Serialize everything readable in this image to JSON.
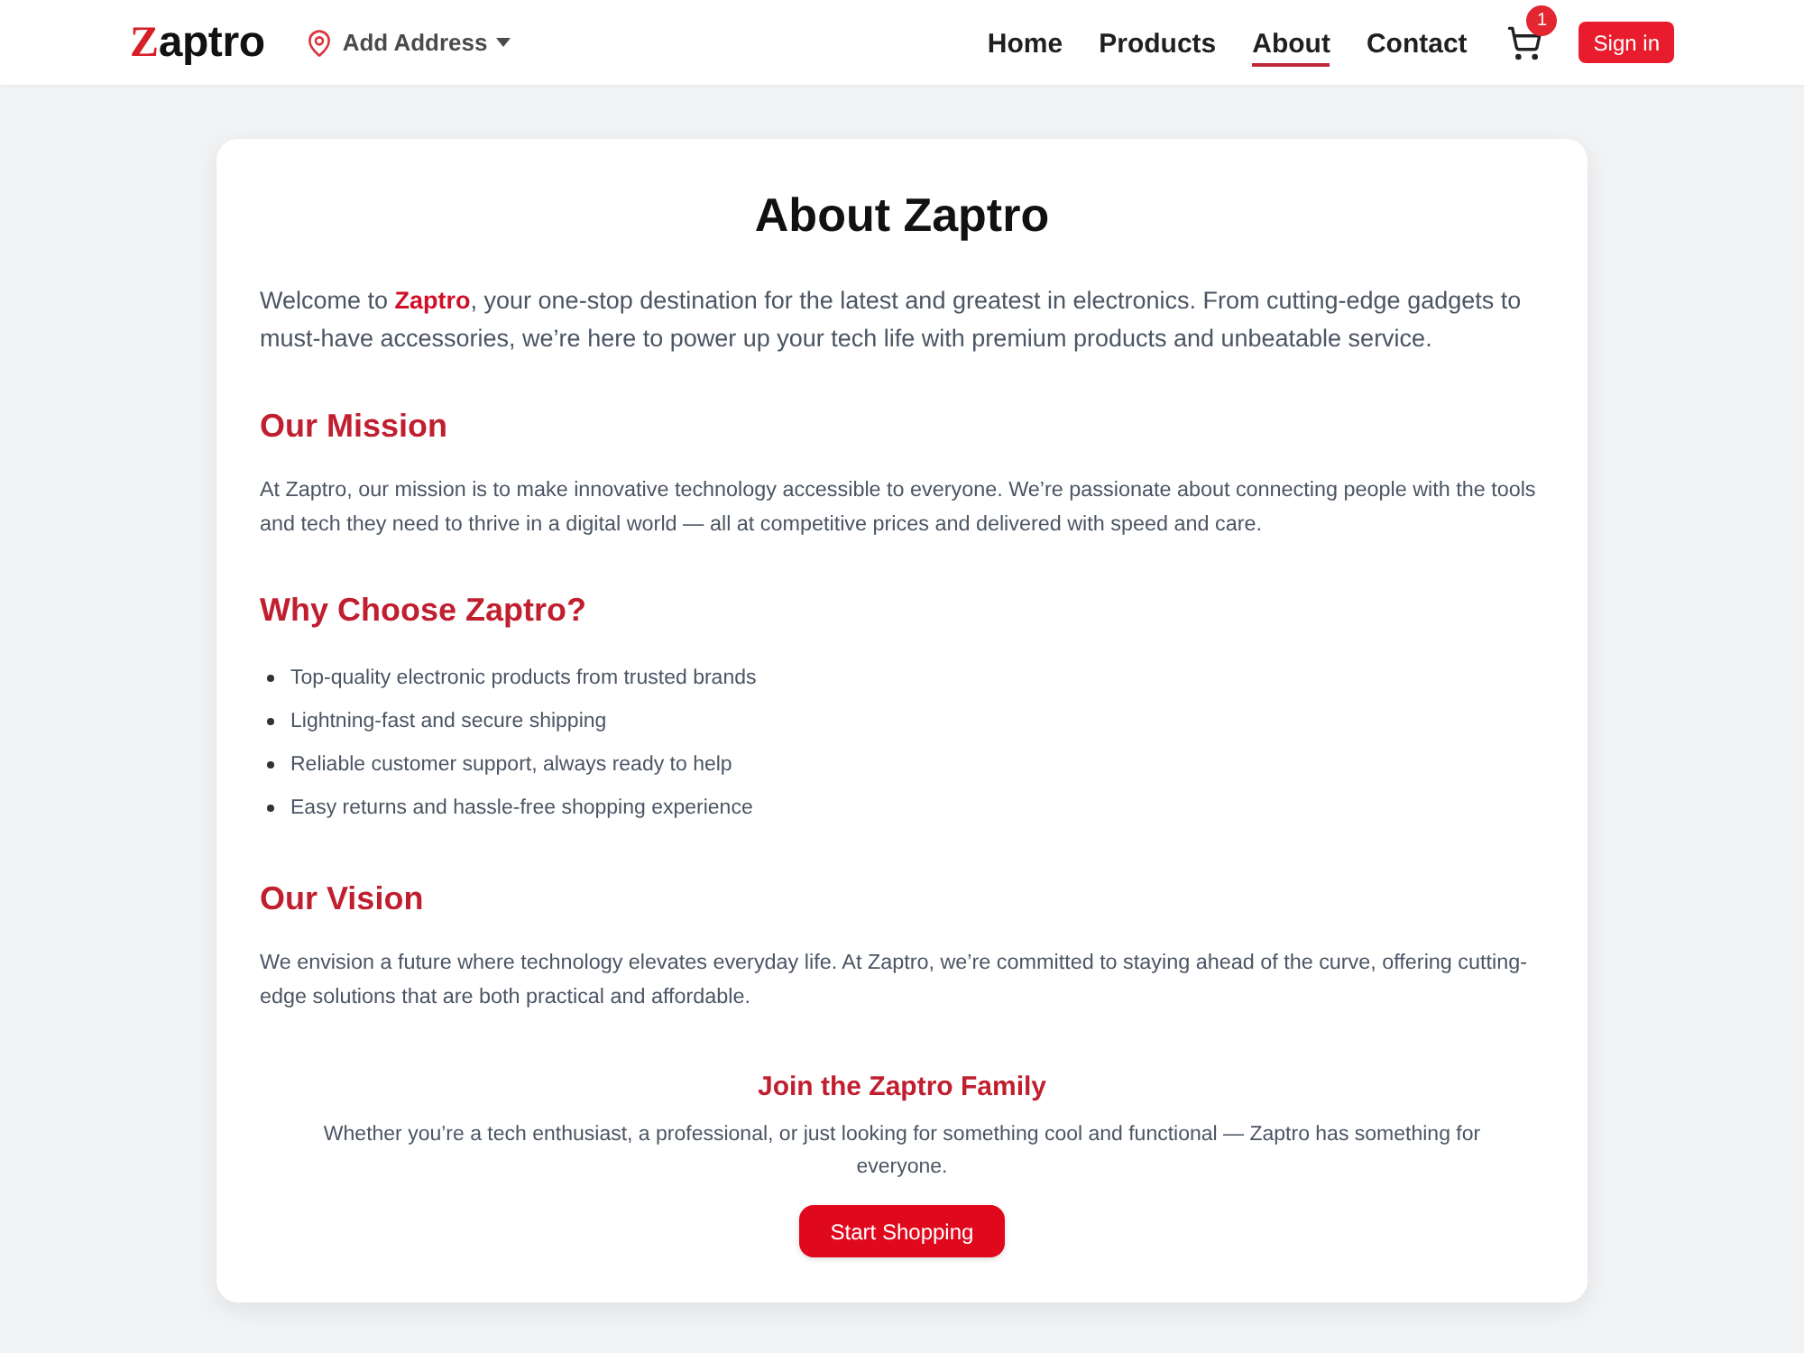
{
  "header": {
    "logo": {
      "accent": "Z",
      "text": "aptro"
    },
    "address_button": {
      "label": "Add Address"
    },
    "nav": [
      {
        "label": "Home",
        "selected": false
      },
      {
        "label": "Products",
        "selected": false
      },
      {
        "label": "About",
        "selected": true
      },
      {
        "label": "Contact",
        "selected": false
      }
    ],
    "cart": {
      "badge": "1"
    },
    "sign_in": {
      "label": "Sign in"
    }
  },
  "about": {
    "title": "About Zaptro",
    "intro": "Welcome to **Zaptro**, your one-stop destination for the latest and greatest in electronics. From cutting-edge gadgets to must-have accessories, we’re here to power up your tech life with premium products and unbeatable service.",
    "sections": [
      {
        "kind": "paragraph",
        "heading": "Our Mission",
        "text": "At Zaptro, our mission is to make innovative technology accessible to everyone. We’re passionate about connecting people with the tools and tech they need to thrive in a digital world — all at competitive prices and delivered with speed and care."
      },
      {
        "kind": "list",
        "heading": "Why Choose Zaptro?",
        "items": [
          "Top-quality electronic products from trusted brands",
          "Lightning-fast and secure shipping",
          "Reliable customer support, always ready to help",
          "Easy returns and hassle-free shopping experience"
        ]
      },
      {
        "kind": "paragraph",
        "heading": "Our Vision",
        "text": "We envision a future where technology elevates everyday life. At Zaptro, we’re committed to staying ahead of the curve, offering cutting-edge solutions that are both practical and affordable."
      }
    ],
    "cta": {
      "heading": "Join the Zaptro Family",
      "text": "Whether you’re a tech enthusiast, a professional, or just looking for something cool and functional — Zaptro has something for everyone.",
      "button": "Start Shopping"
    }
  }
}
